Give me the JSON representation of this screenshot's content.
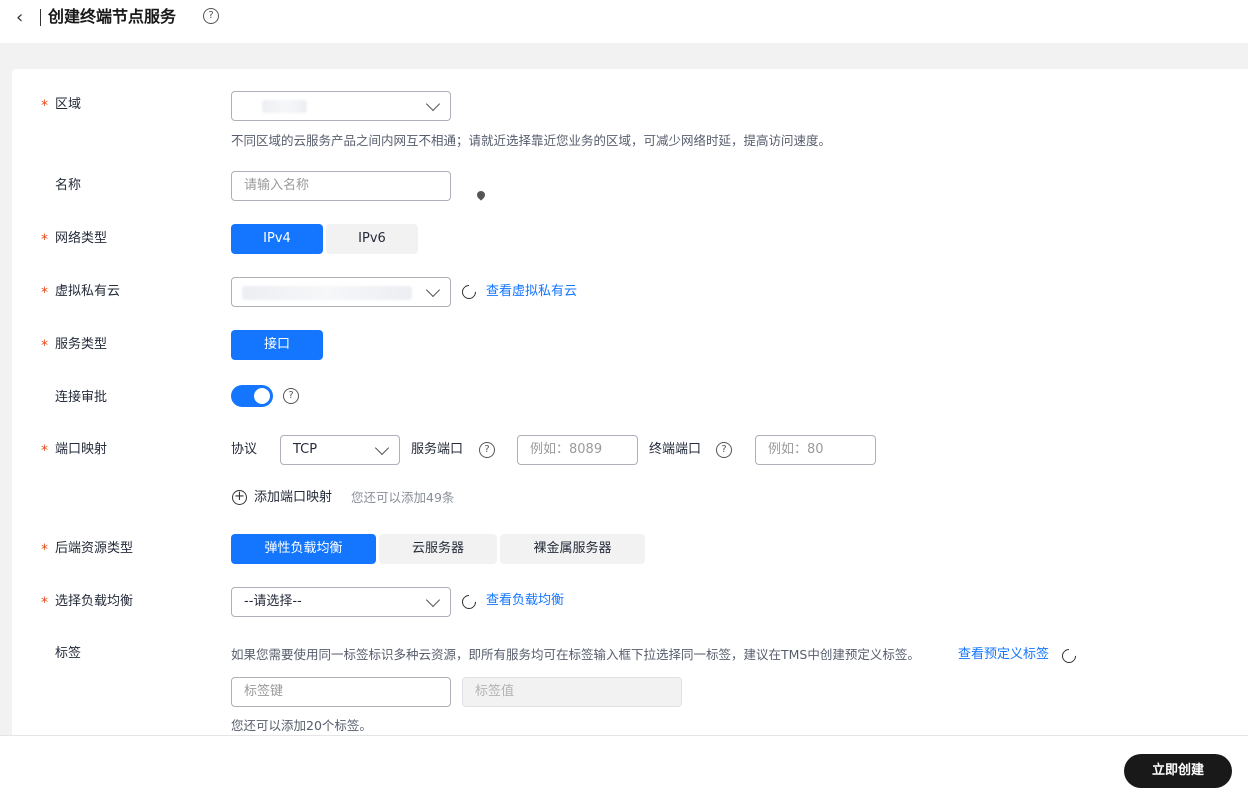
{
  "header": {
    "back_icon": "chevron-left-icon",
    "title": "创建终端节点服务",
    "help_icon": "question-circle-icon"
  },
  "form": {
    "region": {
      "label": "区域",
      "hint": "不同区域的云服务产品之间内网互不相通；请就近选择靠近您业务的区域，可减少网络时延，提高访问速度。"
    },
    "name": {
      "label": "名称",
      "placeholder": "请输入名称"
    },
    "network_type": {
      "label": "网络类型",
      "options": [
        "IPv4",
        "IPv6"
      ],
      "selected": "IPv4"
    },
    "vpc": {
      "label": "虚拟私有云",
      "link": "查看虚拟私有云"
    },
    "service_type": {
      "label": "服务类型",
      "options": [
        "接口"
      ],
      "selected": "接口"
    },
    "connection_approval": {
      "label": "连接审批",
      "enabled": true
    },
    "port_mapping": {
      "label": "端口映射",
      "protocol_label": "协议",
      "protocol_value": "TCP",
      "service_port_label": "服务端口",
      "service_port_placeholder": "例如：8089",
      "terminal_port_label": "终端端口",
      "terminal_port_placeholder": "例如：80",
      "add_label": "添加端口映射",
      "add_hint": "您还可以添加49条"
    },
    "backend_type": {
      "label": "后端资源类型",
      "options": [
        "弹性负载均衡",
        "云服务器",
        "裸金属服务器"
      ],
      "selected": "弹性负载均衡"
    },
    "load_balancer": {
      "label": "选择负载均衡",
      "placeholder": "--请选择--",
      "link": "查看负载均衡"
    },
    "tags": {
      "label": "标签",
      "hint": "如果您需要使用同一标签标识多种云资源，即所有服务均可在标签输入框下拉选择同一标签，建议在TMS中创建预定义标签。",
      "link": "查看预定义标签",
      "key_placeholder": "标签键",
      "value_placeholder": "标签值",
      "remaining": "您还可以添加20个标签。"
    }
  },
  "footer": {
    "create_label": "立即创建"
  },
  "colors": {
    "primary": "#1476ff",
    "required": "#e64a19",
    "create_button": "#191919"
  }
}
